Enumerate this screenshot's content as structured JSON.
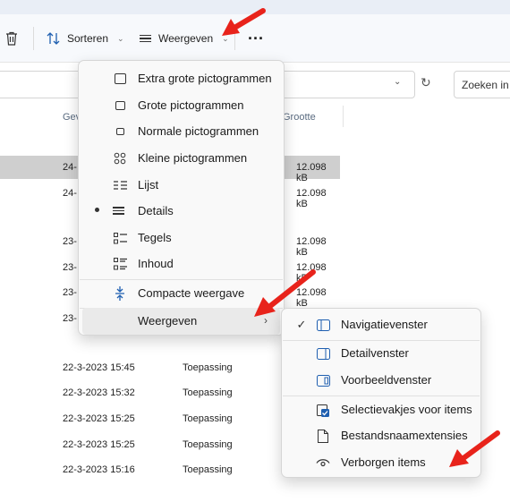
{
  "toolbar": {
    "sort_label": "Sorteren",
    "view_label": "Weergeven",
    "more_label": "..."
  },
  "search": {
    "placeholder": "Zoeken in D"
  },
  "columns": {
    "date_trunc": "Gev",
    "size": "Grootte"
  },
  "rows_top": [
    {
      "date": "24-",
      "size": "12.098 kB"
    },
    {
      "date": "24-",
      "size": "12.098 kB"
    },
    {
      "date": "23-",
      "size": "12.098 kB"
    },
    {
      "date": "23-",
      "size": "12.098 kB"
    },
    {
      "date": "23-",
      "size": "12.098 kB"
    },
    {
      "date": "23-",
      "size": ""
    }
  ],
  "rows_bottom": [
    {
      "date": "22-3-2023 15:45",
      "type": "Toepassing"
    },
    {
      "date": "22-3-2023 15:32",
      "type": "Toepassing"
    },
    {
      "date": "22-3-2023 15:25",
      "type": "Toepassing"
    },
    {
      "date": "22-3-2023 15:25",
      "type": "Toepassing"
    },
    {
      "date": "22-3-2023 15:16",
      "type": "Toepassing"
    }
  ],
  "view_menu": {
    "items": [
      {
        "label": "Extra grote pictogrammen"
      },
      {
        "label": "Grote pictogrammen"
      },
      {
        "label": "Normale pictogrammen"
      },
      {
        "label": "Kleine pictogrammen"
      },
      {
        "label": "Lijst"
      },
      {
        "label": "Details"
      },
      {
        "label": "Tegels"
      },
      {
        "label": "Inhoud"
      }
    ],
    "compact": "Compacte weergave",
    "show": "Weergeven"
  },
  "show_menu": {
    "items": [
      {
        "label": "Navigatievenster"
      },
      {
        "label": "Detailvenster"
      },
      {
        "label": "Voorbeeldvenster"
      },
      {
        "label": "Selectievakjes voor items"
      },
      {
        "label": "Bestandsnaamextensies"
      },
      {
        "label": "Verborgen items"
      }
    ]
  },
  "colors": {
    "arrow": "#e8231b",
    "accent": "#005fb8",
    "selection": "#cfcfcf"
  }
}
